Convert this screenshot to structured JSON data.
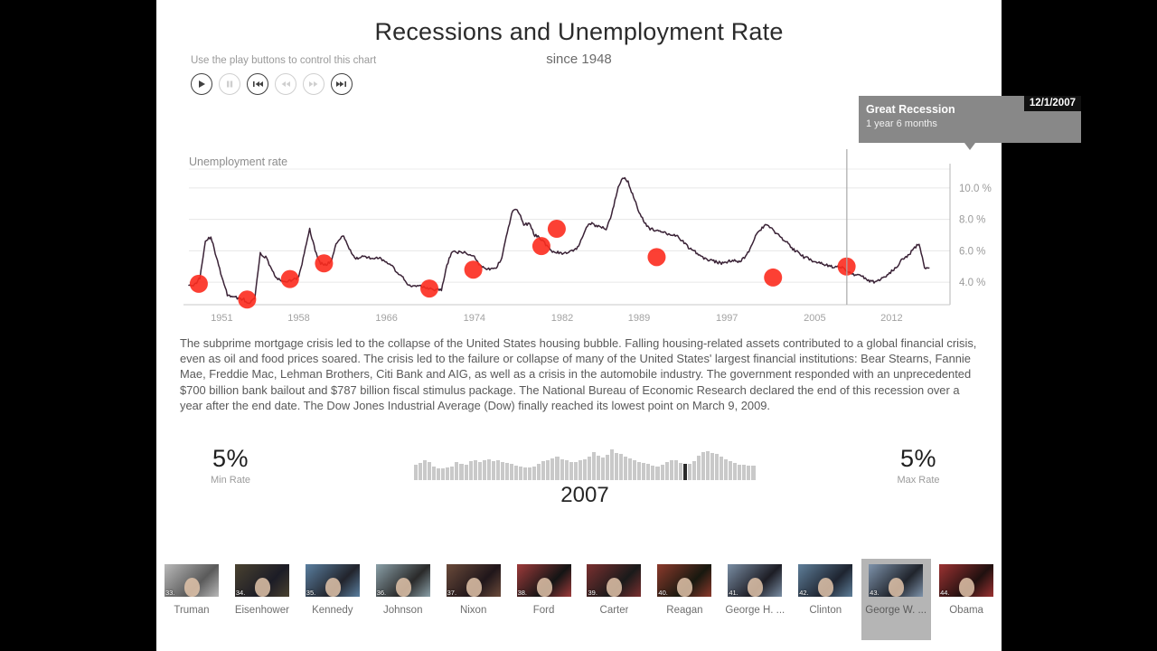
{
  "header": {
    "title": "Recessions and Unemployment Rate",
    "subtitle": "since 1948",
    "play_hint": "Use the play buttons to control this chart"
  },
  "play_controls": [
    {
      "name": "play-button",
      "icon": "play-icon",
      "enabled": true
    },
    {
      "name": "pause-button",
      "icon": "pause-icon",
      "enabled": false
    },
    {
      "name": "skip-to-start-button",
      "icon": "skip-start-icon",
      "enabled": true
    },
    {
      "name": "rewind-button",
      "icon": "rewind-icon",
      "enabled": false
    },
    {
      "name": "fast-forward-button",
      "icon": "fast-forward-icon",
      "enabled": false
    },
    {
      "name": "skip-to-end-button",
      "icon": "skip-end-icon",
      "enabled": true
    }
  ],
  "tooltip": {
    "title": "Great Recession",
    "duration": "1 year 6 months",
    "date": "12/1/2007"
  },
  "description": "The subprime mortgage crisis led to the collapse of the United States housing bubble. Falling housing-related assets contributed to a global financial crisis, even as oil and food prices soared. The crisis led to the failure or collapse of many of the United States' largest financial institutions: Bear Stearns, Fannie Mae, Freddie Mac, Lehman Brothers, Citi Bank and AIG, as well as a crisis in the automobile industry. The government responded with an unprecedented $700 billion bank bailout and $787 billion fiscal stimulus package. The National Bureau of Economic Research declared the end of this recession over a year after the end date. The Dow Jones Industrial Average (Dow) finally reached its lowest point on March 9, 2009.",
  "stats": {
    "min": {
      "value": "5%",
      "label": "Min Rate"
    },
    "max": {
      "value": "5%",
      "label": "Max Rate"
    }
  },
  "scrubber": {
    "current_year": "2007",
    "cursor_index": 59,
    "values": [
      34,
      38,
      44,
      41,
      30,
      27,
      26,
      28,
      31,
      40,
      37,
      35,
      42,
      45,
      40,
      45,
      46,
      43,
      45,
      41,
      38,
      36,
      33,
      30,
      29,
      28,
      31,
      36,
      42,
      45,
      49,
      52,
      46,
      44,
      41,
      40,
      44,
      46,
      52,
      62,
      55,
      50,
      56,
      69,
      60,
      58,
      52,
      48,
      44,
      40,
      38,
      36,
      33,
      31,
      34,
      40,
      45,
      44,
      38,
      36,
      37,
      42,
      55,
      62,
      64,
      60,
      58,
      52,
      46,
      42,
      38,
      35,
      34,
      33,
      32
    ]
  },
  "presidents": [
    {
      "num": "33.",
      "name": "Truman",
      "selected": false,
      "c1": "#b9b9b9",
      "c2": "#5a5a5a"
    },
    {
      "num": "34.",
      "name": "Eisenhower",
      "selected": false,
      "c1": "#4a4230",
      "c2": "#1c1c26"
    },
    {
      "num": "35.",
      "name": "Kennedy",
      "selected": false,
      "c1": "#5a7fa0",
      "c2": "#22242c"
    },
    {
      "num": "36.",
      "name": "Johnson",
      "selected": false,
      "c1": "#8aa0a8",
      "c2": "#2a2a2a"
    },
    {
      "num": "37.",
      "name": "Nixon",
      "selected": false,
      "c1": "#6a4a3a",
      "c2": "#20161a"
    },
    {
      "num": "38.",
      "name": "Ford",
      "selected": false,
      "c1": "#9e3b3b",
      "c2": "#141414"
    },
    {
      "num": "39.",
      "name": "Carter",
      "selected": false,
      "c1": "#7b3030",
      "c2": "#1a1a1a"
    },
    {
      "num": "40.",
      "name": "Reagan",
      "selected": false,
      "c1": "#8c3a2c",
      "c2": "#18180f"
    },
    {
      "num": "41.",
      "name": "George H. ...",
      "selected": false,
      "c1": "#7a8ea4",
      "c2": "#1d1d25"
    },
    {
      "num": "42.",
      "name": "Clinton",
      "selected": false,
      "c1": "#5f7f9a",
      "c2": "#1e2430"
    },
    {
      "num": "43.",
      "name": "George W. ...",
      "selected": true,
      "c1": "#7e93ab",
      "c2": "#20242c"
    },
    {
      "num": "44.",
      "name": "Obama",
      "selected": false,
      "c1": "#9c3232",
      "c2": "#20100f"
    }
  ],
  "chart_data": {
    "type": "line",
    "title": "Unemployment rate",
    "xlabel": "",
    "ylabel": "Unemployment rate",
    "ylim": [
      2.8,
      11.2
    ],
    "yticks": [
      "4.0 %",
      "6.0 %",
      "8.0 %",
      "10.0 %"
    ],
    "ytick_values": [
      4.0,
      6.0,
      8.0,
      10.0
    ],
    "xlim": [
      1948,
      2016
    ],
    "xticks": [
      "1951",
      "1958",
      "1966",
      "1974",
      "1982",
      "1989",
      "1997",
      "2005",
      "2012"
    ],
    "xtick_values": [
      1951,
      1958,
      1966,
      1974,
      1982,
      1989,
      1997,
      2005,
      2012
    ],
    "grid": true,
    "line_color": "#3a2236",
    "marker_color": "#fc2b1e",
    "cursor_x": 2007.92,
    "series": [
      {
        "name": "Unemployment rate",
        "x": [
          1948.0,
          1948.5,
          1949.0,
          1949.5,
          1950.0,
          1950.5,
          1951.0,
          1951.5,
          1952.0,
          1952.5,
          1953.0,
          1953.5,
          1954.0,
          1954.5,
          1955.0,
          1955.5,
          1956.0,
          1956.5,
          1957.0,
          1957.5,
          1958.0,
          1958.5,
          1959.0,
          1959.5,
          1960.0,
          1960.5,
          1961.0,
          1961.5,
          1962.0,
          1962.5,
          1963.0,
          1963.5,
          1964.0,
          1964.5,
          1965.0,
          1965.5,
          1966.0,
          1966.5,
          1967.0,
          1967.5,
          1968.0,
          1968.5,
          1969.0,
          1969.5,
          1970.0,
          1970.5,
          1971.0,
          1971.5,
          1972.0,
          1972.5,
          1973.0,
          1973.5,
          1974.0,
          1974.5,
          1975.0,
          1975.5,
          1976.0,
          1976.5,
          1977.0,
          1977.5,
          1978.0,
          1978.5,
          1979.0,
          1979.5,
          1980.0,
          1980.5,
          1981.0,
          1981.5,
          1982.0,
          1982.5,
          1983.0,
          1983.5,
          1984.0,
          1984.5,
          1985.0,
          1985.5,
          1986.0,
          1986.5,
          1987.0,
          1987.5,
          1988.0,
          1988.5,
          1989.0,
          1989.5,
          1990.0,
          1990.5,
          1991.0,
          1991.5,
          1992.0,
          1992.5,
          1993.0,
          1993.5,
          1994.0,
          1994.5,
          1995.0,
          1995.5,
          1996.0,
          1996.5,
          1997.0,
          1997.5,
          1998.0,
          1998.5,
          1999.0,
          1999.5,
          2000.0,
          2000.5,
          2001.0,
          2001.5,
          2002.0,
          2002.5,
          2003.0,
          2003.5,
          2004.0,
          2004.5,
          2005.0,
          2005.5,
          2006.0,
          2006.5,
          2007.0,
          2007.5,
          2008.0,
          2008.5,
          2009.0,
          2009.5,
          2010.0,
          2010.5,
          2011.0,
          2011.5,
          2012.0,
          2012.5,
          2013.0,
          2013.5,
          2014.0,
          2014.5,
          2015.0,
          2015.5,
          2016.0
        ],
        "y": [
          3.9,
          3.8,
          4.3,
          6.6,
          6.9,
          5.6,
          4.3,
          3.2,
          3.1,
          3.0,
          2.9,
          2.6,
          3.0,
          5.8,
          5.6,
          4.9,
          4.2,
          4.1,
          4.0,
          4.2,
          4.3,
          5.8,
          7.4,
          6.0,
          5.2,
          5.1,
          5.4,
          6.6,
          7.0,
          6.3,
          5.6,
          5.5,
          5.7,
          5.5,
          5.6,
          5.5,
          5.2,
          5.0,
          4.6,
          4.3,
          3.8,
          3.7,
          3.8,
          3.7,
          3.6,
          3.5,
          3.5,
          5.1,
          6.0,
          5.9,
          5.9,
          5.8,
          5.6,
          5.1,
          4.9,
          4.8,
          4.9,
          5.6,
          7.2,
          8.6,
          8.5,
          7.7,
          7.7,
          7.0,
          6.8,
          6.4,
          6.0,
          5.9,
          5.8,
          5.9,
          6.0,
          6.3,
          7.2,
          7.8,
          7.6,
          7.5,
          7.4,
          8.3,
          9.8,
          10.7,
          10.4,
          9.4,
          8.5,
          7.8,
          7.4,
          7.3,
          7.2,
          7.1,
          7.0,
          6.9,
          6.6,
          6.2,
          6.0,
          5.7,
          5.5,
          5.4,
          5.3,
          5.2,
          5.3,
          5.4,
          5.3,
          5.5,
          6.0,
          6.8,
          7.3,
          7.6,
          7.5,
          7.1,
          6.8,
          6.5,
          6.1,
          5.9,
          5.6,
          5.5,
          5.3,
          5.2,
          5.1,
          5.0,
          5.0,
          4.9,
          4.7,
          4.5,
          4.4,
          4.3,
          4.1,
          4.0,
          4.2,
          4.4,
          4.7,
          5.0,
          5.5,
          5.7,
          6.1,
          6.5,
          4.9,
          4.9
        ]
      }
    ],
    "recession_markers": [
      {
        "year": 1948.9,
        "value": 3.9
      },
      {
        "year": 1953.3,
        "value": 2.9
      },
      {
        "year": 1957.2,
        "value": 4.2
      },
      {
        "year": 1960.3,
        "value": 5.2
      },
      {
        "year": 1969.9,
        "value": 3.6
      },
      {
        "year": 1973.9,
        "value": 4.8
      },
      {
        "year": 1980.1,
        "value": 6.3
      },
      {
        "year": 1981.5,
        "value": 7.4
      },
      {
        "year": 1990.6,
        "value": 5.6
      },
      {
        "year": 2001.2,
        "value": 4.3
      },
      {
        "year": 2007.9,
        "value": 5.0
      }
    ]
  }
}
